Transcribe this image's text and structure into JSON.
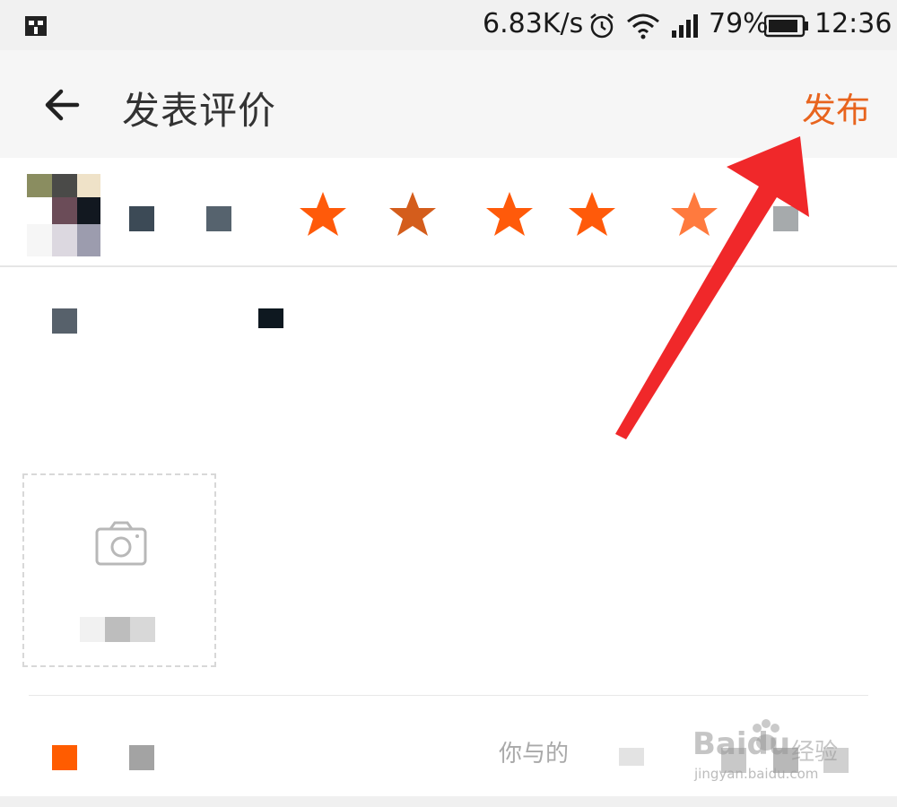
{
  "status_bar": {
    "network_speed": "6.83K/s",
    "battery_percent": "79%",
    "time": "12:36",
    "icons": [
      "app-icon",
      "alarm-icon",
      "wifi-icon",
      "signal-icon",
      "battery-icon"
    ]
  },
  "app_bar": {
    "title": "发表评价",
    "publish_label": "发布",
    "accent_color": "#e8641e"
  },
  "product": {
    "rating_stars_total": 5,
    "rating_color": "#ff5a0a"
  },
  "comment": {
    "placeholder": ""
  },
  "photo": {
    "label": ""
  },
  "footer": {
    "hint": "你与的",
    "watermark_logo": "Baidu",
    "watermark_sub": "经验",
    "watermark_url": "jingyan.baidu.com"
  }
}
